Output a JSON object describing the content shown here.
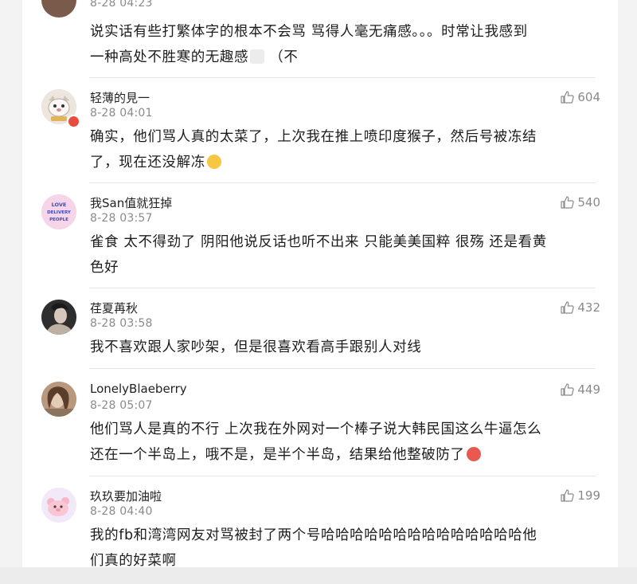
{
  "comments": [
    {
      "username": "",
      "time": "8-28 04:23",
      "likes": "",
      "text_line1": "说实话有些打繁体字的根本不会骂 骂得人毫无痛感。。。时常让我感到",
      "text_line2": "一种高处不胜寒的无趣感",
      "text_tail": "（不",
      "avatar_color": "#7a5a4a"
    },
    {
      "username": "轻薄的見一",
      "time": "8-28 04:01",
      "likes": "604",
      "text_line1": "确实，他们骂人真的太菜了，上次我在推上喷印度猴子，然后号被冻结",
      "text_line2": "了，现在还没解冻",
      "avatar_color": "#d9cfc6",
      "badge_color": "#e74c3c"
    },
    {
      "username": "我San值就狂掉",
      "time": "8-28 03:57",
      "likes": "540",
      "text_line1": "雀食 太不得劲了 阴阳他说反话也听不出来 只能美美国粹 很殇 还是看黄",
      "text_line2": "色好",
      "avatar_color": "#f4d2e6",
      "avatar_text": "LOVE DELIVERY PEOPLE",
      "avatar_text_color": "#3b49c4"
    },
    {
      "username": "荏夏苒秋",
      "time": "8-28 03:58",
      "likes": "432",
      "text_line1": "我不喜欢跟人家吵架，但是很喜欢看高手跟别人对线",
      "avatar_color": "#3a3a3a"
    },
    {
      "username": "LonelyBlaeberry",
      "time": "8-28 05:07",
      "likes": "449",
      "text_line1": "他们骂人是真的不行 上次我在外网对一个棒子说大韩民国这么牛逼怎么",
      "text_line2": "还在一个半岛上，哦不是，是半个半岛，结果给他整破防了",
      "avatar_color": "#a4876e"
    },
    {
      "username": "玖玖要加油啦",
      "time": "8-28 04:40",
      "likes": "199",
      "text_line1": "我的fb和湾湾网友对骂被封了两个号哈哈哈哈哈哈哈哈哈哈哈哈哈哈他",
      "text_line2": "们真的好菜啊",
      "avatar_color": "#efe6f7"
    }
  ],
  "colors": {
    "like_icon": "#8a8a8a",
    "badge": "#e74c3c"
  },
  "icons": {
    "like": "thumbs-up-icon"
  }
}
